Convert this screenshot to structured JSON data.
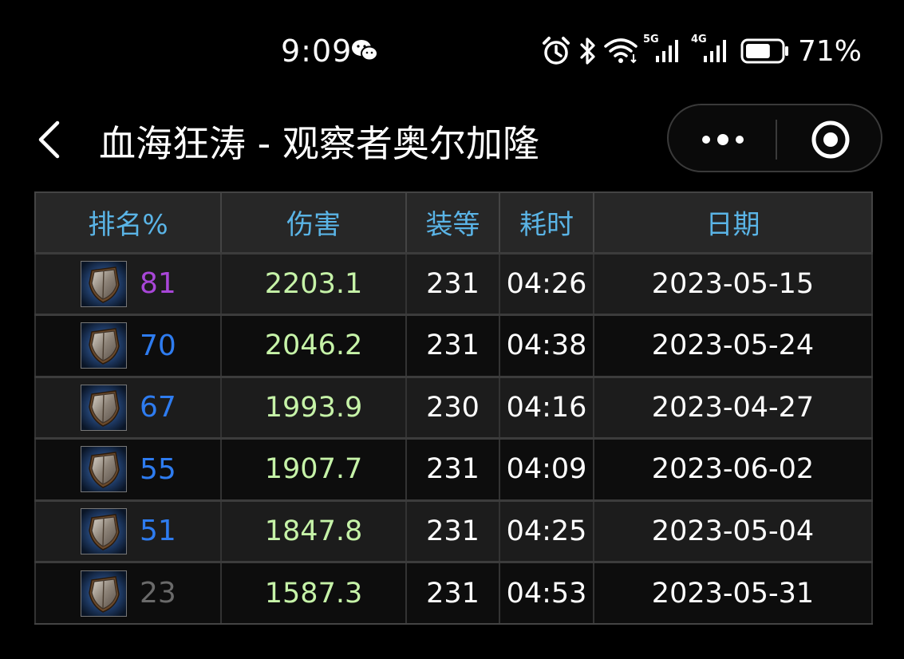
{
  "status_bar": {
    "time": "9:09",
    "battery_percent": "71%",
    "battery_level": 0.71,
    "network_1": "5G",
    "network_2": "4G"
  },
  "nav": {
    "title": "血海狂涛 - 观察者奥尔加隆"
  },
  "table": {
    "headers": [
      "排名%",
      "伤害",
      "装等",
      "耗时",
      "日期"
    ],
    "rows": [
      {
        "rank": "81",
        "rank_color": "#a846d8",
        "damage": "2203.1",
        "ilvl": "231",
        "time": "04:26",
        "date": "2023-05-15"
      },
      {
        "rank": "70",
        "rank_color": "#2e7cf0",
        "damage": "2046.2",
        "ilvl": "231",
        "time": "04:38",
        "date": "2023-05-24"
      },
      {
        "rank": "67",
        "rank_color": "#2e7cf0",
        "damage": "1993.9",
        "ilvl": "230",
        "time": "04:16",
        "date": "2023-04-27"
      },
      {
        "rank": "55",
        "rank_color": "#2e7cf0",
        "damage": "1907.7",
        "ilvl": "231",
        "time": "04:09",
        "date": "2023-06-02"
      },
      {
        "rank": "51",
        "rank_color": "#2e7cf0",
        "damage": "1847.8",
        "ilvl": "231",
        "time": "04:25",
        "date": "2023-05-04"
      },
      {
        "rank": "23",
        "rank_color": "#6a6a6a",
        "damage": "1587.3",
        "ilvl": "231",
        "time": "04:53",
        "date": "2023-05-31"
      }
    ]
  },
  "colors": {
    "header_text": "#5ab4e6",
    "damage_text": "#c6f3a8",
    "background": "#000000"
  },
  "icons": {
    "spec_icon": "protection-shield-icon"
  }
}
